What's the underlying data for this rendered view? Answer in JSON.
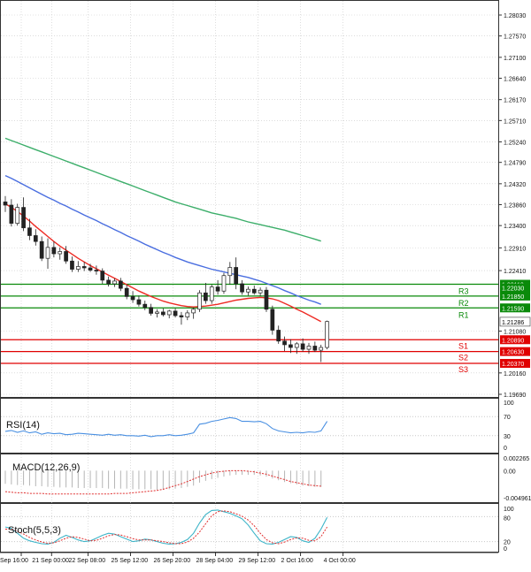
{
  "chart_data": {
    "type": "candlestick",
    "instrument_note": "",
    "main_panel": {
      "ylim": [
        1.1969,
        1.2803
      ],
      "price_ticks": [
        "1.28030",
        "1.27570",
        "1.27100",
        "1.26640",
        "1.26170",
        "1.25710",
        "1.25240",
        "1.24790",
        "1.24320",
        "1.23860",
        "1.23400",
        "1.22910",
        "1.22410",
        "1.21080",
        "1.20160",
        "1.19690"
      ],
      "levels": [
        {
          "name": "R3",
          "price": 1.2211,
          "label": "1.22110",
          "color": "#0a8a0a"
        },
        {
          "name": "R2",
          "price": 1.2185,
          "label": "1.21850",
          "color": "#0a8a0a"
        },
        {
          "name": "R1",
          "price": 1.2159,
          "label": "1.21590",
          "color": "#0a8a0a"
        },
        {
          "name": "S1",
          "price": 1.2089,
          "label": "1.20890",
          "color": "#e00000"
        },
        {
          "name": "S2",
          "price": 1.2063,
          "label": "1.20630",
          "color": "#e00000"
        },
        {
          "name": "S3",
          "price": 1.2037,
          "label": "1.20370",
          "color": "#e00000"
        }
      ],
      "current_price": {
        "value": 1.21286,
        "label": "1.21286"
      },
      "extra_label": {
        "value": 1.2203,
        "label": "1.22030"
      },
      "candles": [
        [
          1.2392,
          1.2405,
          1.237,
          1.2385
        ],
        [
          1.2385,
          1.2398,
          1.2338,
          1.2345
        ],
        [
          1.2345,
          1.2388,
          1.234,
          1.238
        ],
        [
          1.238,
          1.2402,
          1.2328,
          1.2335
        ],
        [
          1.2335,
          1.2355,
          1.2308,
          1.2318
        ],
        [
          1.2318,
          1.2332,
          1.2296,
          1.2305
        ],
        [
          1.2305,
          1.2316,
          1.2262,
          1.2268
        ],
        [
          1.2268,
          1.2312,
          1.2245,
          1.2292
        ],
        [
          1.2292,
          1.2305,
          1.227,
          1.2278
        ],
        [
          1.2278,
          1.2292,
          1.2265,
          1.2283
        ],
        [
          1.2283,
          1.2295,
          1.2256,
          1.2262
        ],
        [
          1.2262,
          1.2272,
          1.2238,
          1.2244
        ],
        [
          1.2244,
          1.2262,
          1.2238,
          1.225
        ],
        [
          1.225,
          1.226,
          1.224,
          1.2247
        ],
        [
          1.2247,
          1.2256,
          1.2238,
          1.2242
        ],
        [
          1.2242,
          1.2252,
          1.2232,
          1.224
        ],
        [
          1.224,
          1.2246,
          1.2212,
          1.222
        ],
        [
          1.222,
          1.2228,
          1.2206,
          1.2212
        ],
        [
          1.2212,
          1.2224,
          1.2205,
          1.2218
        ],
        [
          1.2218,
          1.2225,
          1.2196,
          1.2202
        ],
        [
          1.2202,
          1.221,
          1.2178,
          1.2184
        ],
        [
          1.2184,
          1.2196,
          1.217,
          1.2177
        ],
        [
          1.2177,
          1.2186,
          1.2162,
          1.2167
        ],
        [
          1.2167,
          1.2175,
          1.2154,
          1.216
        ],
        [
          1.216,
          1.2168,
          1.2142,
          1.2147
        ],
        [
          1.2147,
          1.2156,
          1.2138,
          1.215
        ],
        [
          1.215,
          1.2158,
          1.214,
          1.2144
        ],
        [
          1.2144,
          1.2155,
          1.2136,
          1.2152
        ],
        [
          1.2152,
          1.2158,
          1.2138,
          1.2142
        ],
        [
          1.2142,
          1.215,
          1.2122,
          1.2139
        ],
        [
          1.2139,
          1.2154,
          1.2132,
          1.2148
        ],
        [
          1.2148,
          1.216,
          1.2135,
          1.2156
        ],
        [
          1.2156,
          1.2198,
          1.215,
          1.2192
        ],
        [
          1.2192,
          1.2214,
          1.2168,
          1.2175
        ],
        [
          1.2175,
          1.221,
          1.2168,
          1.2205
        ],
        [
          1.2205,
          1.222,
          1.2188,
          1.2196
        ],
        [
          1.2196,
          1.2236,
          1.219,
          1.223
        ],
        [
          1.223,
          1.226,
          1.221,
          1.2248
        ],
        [
          1.2248,
          1.227,
          1.22,
          1.2212
        ],
        [
          1.2212,
          1.222,
          1.2188,
          1.2194
        ],
        [
          1.2194,
          1.2206,
          1.2186,
          1.22
        ],
        [
          1.22,
          1.2208,
          1.2188,
          1.2192
        ],
        [
          1.2192,
          1.2204,
          1.2185,
          1.2198
        ],
        [
          1.2198,
          1.2205,
          1.215,
          1.2156
        ],
        [
          1.2156,
          1.2164,
          1.21,
          1.211
        ],
        [
          1.211,
          1.212,
          1.208,
          1.2086
        ],
        [
          1.2086,
          1.2096,
          1.2064,
          1.2078
        ],
        [
          1.2078,
          1.209,
          1.206,
          1.2072
        ],
        [
          1.2072,
          1.2084,
          1.2058,
          1.208
        ],
        [
          1.208,
          1.2092,
          1.2063,
          1.2068
        ],
        [
          1.2068,
          1.2082,
          1.2058,
          1.2075
        ],
        [
          1.2075,
          1.2085,
          1.2062,
          1.2066
        ],
        [
          1.2066,
          1.2078,
          1.204,
          1.2072
        ],
        [
          1.2072,
          1.2131,
          1.2068,
          1.2129
        ]
      ],
      "ma_fast": [
        1.2388,
        1.238,
        1.2371,
        1.2361,
        1.235,
        1.2338,
        1.2327,
        1.2316,
        1.2305,
        1.2295,
        1.2286,
        1.2277,
        1.2268,
        1.226,
        1.2252,
        1.2245,
        1.2238,
        1.2231,
        1.2224,
        1.2217,
        1.221,
        1.2203,
        1.2196,
        1.219,
        1.2184,
        1.2179,
        1.2174,
        1.217,
        1.2167,
        1.2164,
        1.2162,
        1.2161,
        1.2162,
        1.2163,
        1.2165,
        1.2167,
        1.217,
        1.2173,
        1.2176,
        1.2178,
        1.218,
        1.2181,
        1.2182,
        1.2181,
        1.2179,
        1.2175,
        1.2169,
        1.2163,
        1.2156,
        1.215,
        1.2143,
        1.2136,
        1.2129
      ],
      "ma_mid": [
        1.245,
        1.2444,
        1.2437,
        1.243,
        1.2423,
        1.2416,
        1.2409,
        1.2402,
        1.2396,
        1.2389,
        1.2383,
        1.2376,
        1.237,
        1.2363,
        1.2357,
        1.2351,
        1.2344,
        1.2338,
        1.2331,
        1.2325,
        1.2318,
        1.2312,
        1.2306,
        1.2299,
        1.2293,
        1.2287,
        1.2281,
        1.2276,
        1.227,
        1.2265,
        1.226,
        1.2256,
        1.2252,
        1.2248,
        1.2244,
        1.2241,
        1.2238,
        1.2235,
        1.2232,
        1.2229,
        1.2226,
        1.2222,
        1.2218,
        1.2213,
        1.2208,
        1.2203,
        1.2197,
        1.2192,
        1.2186,
        1.2181,
        1.2176,
        1.2172,
        1.2167
      ],
      "ma_slow": [
        1.2532,
        1.2527,
        1.2522,
        1.2517,
        1.2512,
        1.2507,
        1.2502,
        1.2497,
        1.2492,
        1.2487,
        1.2482,
        1.2477,
        1.2472,
        1.2467,
        1.2462,
        1.2457,
        1.2452,
        1.2447,
        1.2442,
        1.2437,
        1.2432,
        1.2427,
        1.2422,
        1.2417,
        1.2412,
        1.2407,
        1.2402,
        1.2397,
        1.2392,
        1.2388,
        1.2384,
        1.238,
        1.2376,
        1.2372,
        1.2368,
        1.2365,
        1.2362,
        1.2359,
        1.2356,
        1.2352,
        1.2348,
        1.2345,
        1.2342,
        1.2339,
        1.2336,
        1.2333,
        1.233,
        1.2326,
        1.2322,
        1.2318,
        1.2314,
        1.231,
        1.2306
      ]
    },
    "rsi_panel": {
      "title": "RSI(14)",
      "ticks": [
        "100",
        "70",
        "30",
        "0"
      ],
      "ylim": [
        0,
        100
      ],
      "values": [
        39,
        41,
        37,
        40,
        36,
        38,
        33,
        36,
        34,
        35,
        32,
        33,
        35,
        34,
        33,
        32,
        31,
        33,
        31,
        32,
        30,
        30,
        29,
        31,
        28,
        30,
        30,
        32,
        30,
        31,
        33,
        36,
        54,
        56,
        60,
        62,
        65,
        68,
        66,
        60,
        60,
        59,
        60,
        55,
        45,
        40,
        38,
        36,
        37,
        36,
        38,
        37,
        40,
        60
      ]
    },
    "macd_panel": {
      "title": "MACD(12,26,9)",
      "ticks": [
        "0.002265",
        "0.00",
        "-0.004961"
      ],
      "ylim": [
        -0.004961,
        0.002265
      ],
      "histogram": [
        -0.0022,
        -0.0023,
        -0.0024,
        -0.0024,
        -0.0025,
        -0.0026,
        -0.0026,
        -0.0027,
        -0.0027,
        -0.0028,
        -0.0028,
        -0.0028,
        -0.0029,
        -0.0029,
        -0.0029,
        -0.0029,
        -0.0029,
        -0.003,
        -0.003,
        -0.003,
        -0.003,
        -0.0031,
        -0.0031,
        -0.0031,
        -0.0031,
        -0.0032,
        -0.0032,
        -0.0031,
        -0.003,
        -0.0029,
        -0.0027,
        -0.0025,
        -0.002,
        -0.0017,
        -0.0014,
        -0.0012,
        -0.001,
        -0.0008,
        -0.0007,
        -0.0007,
        -0.0007,
        -0.0007,
        -0.0008,
        -0.001,
        -0.0013,
        -0.0016,
        -0.0019,
        -0.0021,
        -0.0023,
        -0.0025,
        -0.0026,
        -0.0027,
        -0.0027
      ],
      "signal": [
        -0.0035,
        -0.0036,
        -0.0037,
        -0.0037,
        -0.0038,
        -0.0038,
        -0.0038,
        -0.0039,
        -0.0039,
        -0.0039,
        -0.0039,
        -0.0039,
        -0.0039,
        -0.0039,
        -0.0039,
        -0.0039,
        -0.0039,
        -0.0039,
        -0.0038,
        -0.0038,
        -0.0038,
        -0.0037,
        -0.0036,
        -0.0035,
        -0.0034,
        -0.0033,
        -0.0031,
        -0.0028,
        -0.0025,
        -0.0022,
        -0.0018,
        -0.0014,
        -0.001,
        -0.0007,
        -0.0004,
        -0.0002,
        -0.0001,
        0.0,
        0.0,
        0.0,
        -0.0001,
        -0.0002,
        -0.0004,
        -0.0006,
        -0.0009,
        -0.0012,
        -0.0015,
        -0.0018,
        -0.002,
        -0.0022,
        -0.0024,
        -0.0025,
        -0.0026
      ]
    },
    "stoch_panel": {
      "title": "Stoch(5,5,3)",
      "ticks": [
        "100",
        "80",
        "20",
        "0"
      ],
      "ylim": [
        0,
        100
      ],
      "k": [
        55,
        52,
        40,
        28,
        22,
        18,
        15,
        14,
        18,
        28,
        35,
        30,
        24,
        20,
        22,
        28,
        35,
        40,
        38,
        32,
        26,
        20,
        22,
        26,
        24,
        20,
        16,
        14,
        15,
        18,
        25,
        40,
        65,
        85,
        95,
        96,
        92,
        88,
        82,
        75,
        60,
        40,
        22,
        15,
        14,
        18,
        25,
        32,
        30,
        22,
        18,
        28,
        50,
        78
      ],
      "d": [
        50,
        50,
        45,
        38,
        30,
        24,
        19,
        16,
        17,
        22,
        28,
        32,
        30,
        26,
        22,
        23,
        28,
        34,
        37,
        36,
        32,
        27,
        24,
        24,
        24,
        22,
        20,
        17,
        15,
        15,
        19,
        28,
        43,
        63,
        82,
        92,
        94,
        92,
        87,
        81,
        72,
        58,
        40,
        25,
        17,
        15,
        19,
        25,
        29,
        28,
        23,
        22,
        32,
        55
      ]
    },
    "time_labels": [
      {
        "label": "Sep 16:00",
        "bar": 0
      },
      {
        "label": "21 Sep 00:00",
        "bar": 5
      },
      {
        "label": "22 Sep 08:00",
        "bar": 11
      },
      {
        "label": "25 Sep 12:00",
        "bar": 18
      },
      {
        "label": "26 Sep 20:00",
        "bar": 25
      },
      {
        "label": "28 Sep 04:00",
        "bar": 32
      },
      {
        "label": "29 Sep 12:00",
        "bar": 39
      },
      {
        "label": "2 Oct 16:00",
        "bar": 46
      },
      {
        "label": "4 Oct 00:00",
        "bar": 53
      }
    ]
  },
  "colors": {
    "bull": "#1f7a1f",
    "bear": "#c21d1d",
    "ma_fast": "#ee2b24",
    "ma_mid": "#4a6ee0",
    "ma_slow": "#3cae6a",
    "rsi": "#4a90e2",
    "macd_hist": "#b5b5b5",
    "macd_signal": "#e03030",
    "stoch_k": "#3cb4c8",
    "stoch_d": "#e03030",
    "current": "#ffffff"
  }
}
